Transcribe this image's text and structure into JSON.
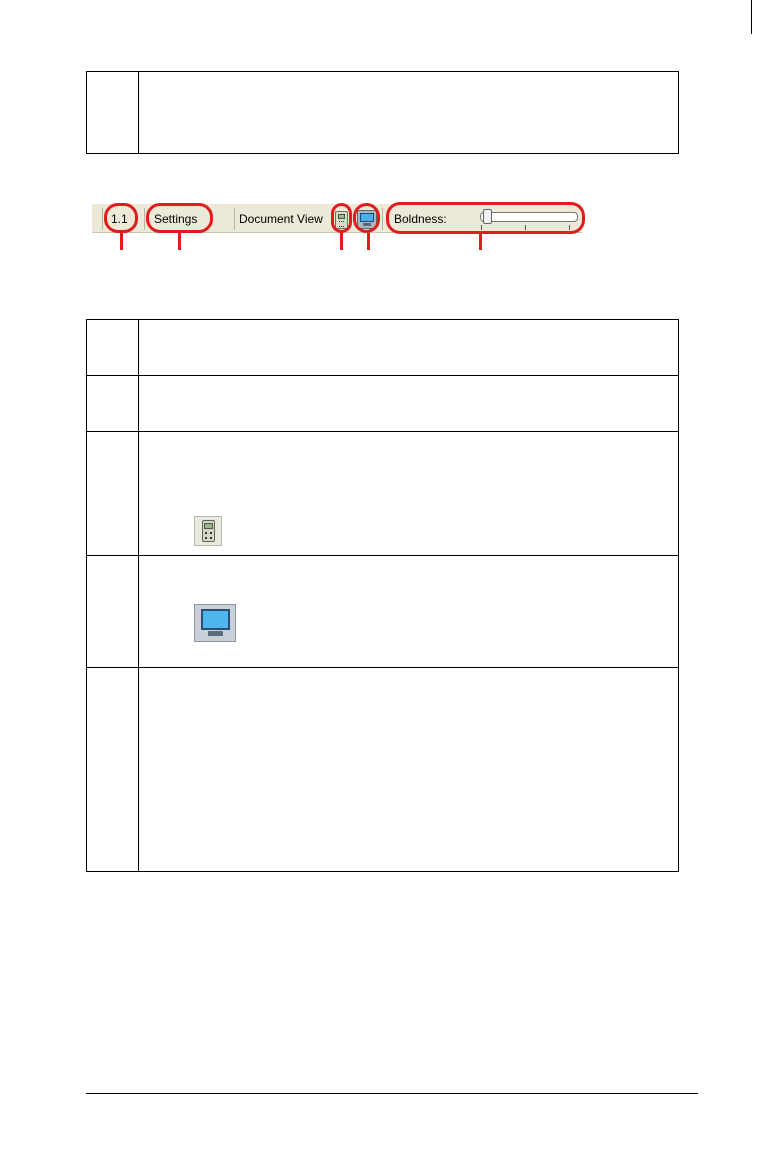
{
  "status_bar": {
    "page_number": "1.1",
    "settings_label": "Settings",
    "document_view_label": "Document View",
    "boldness_label": "Boldness:",
    "boldness_level_fraction": 0.03,
    "handheld_icon": "handheld-view-icon",
    "computer_icon": "computer-view-icon"
  },
  "callouts": {
    "color": "#e11c1c"
  },
  "tables": {
    "top_rows": 1,
    "main_rows": 5
  }
}
